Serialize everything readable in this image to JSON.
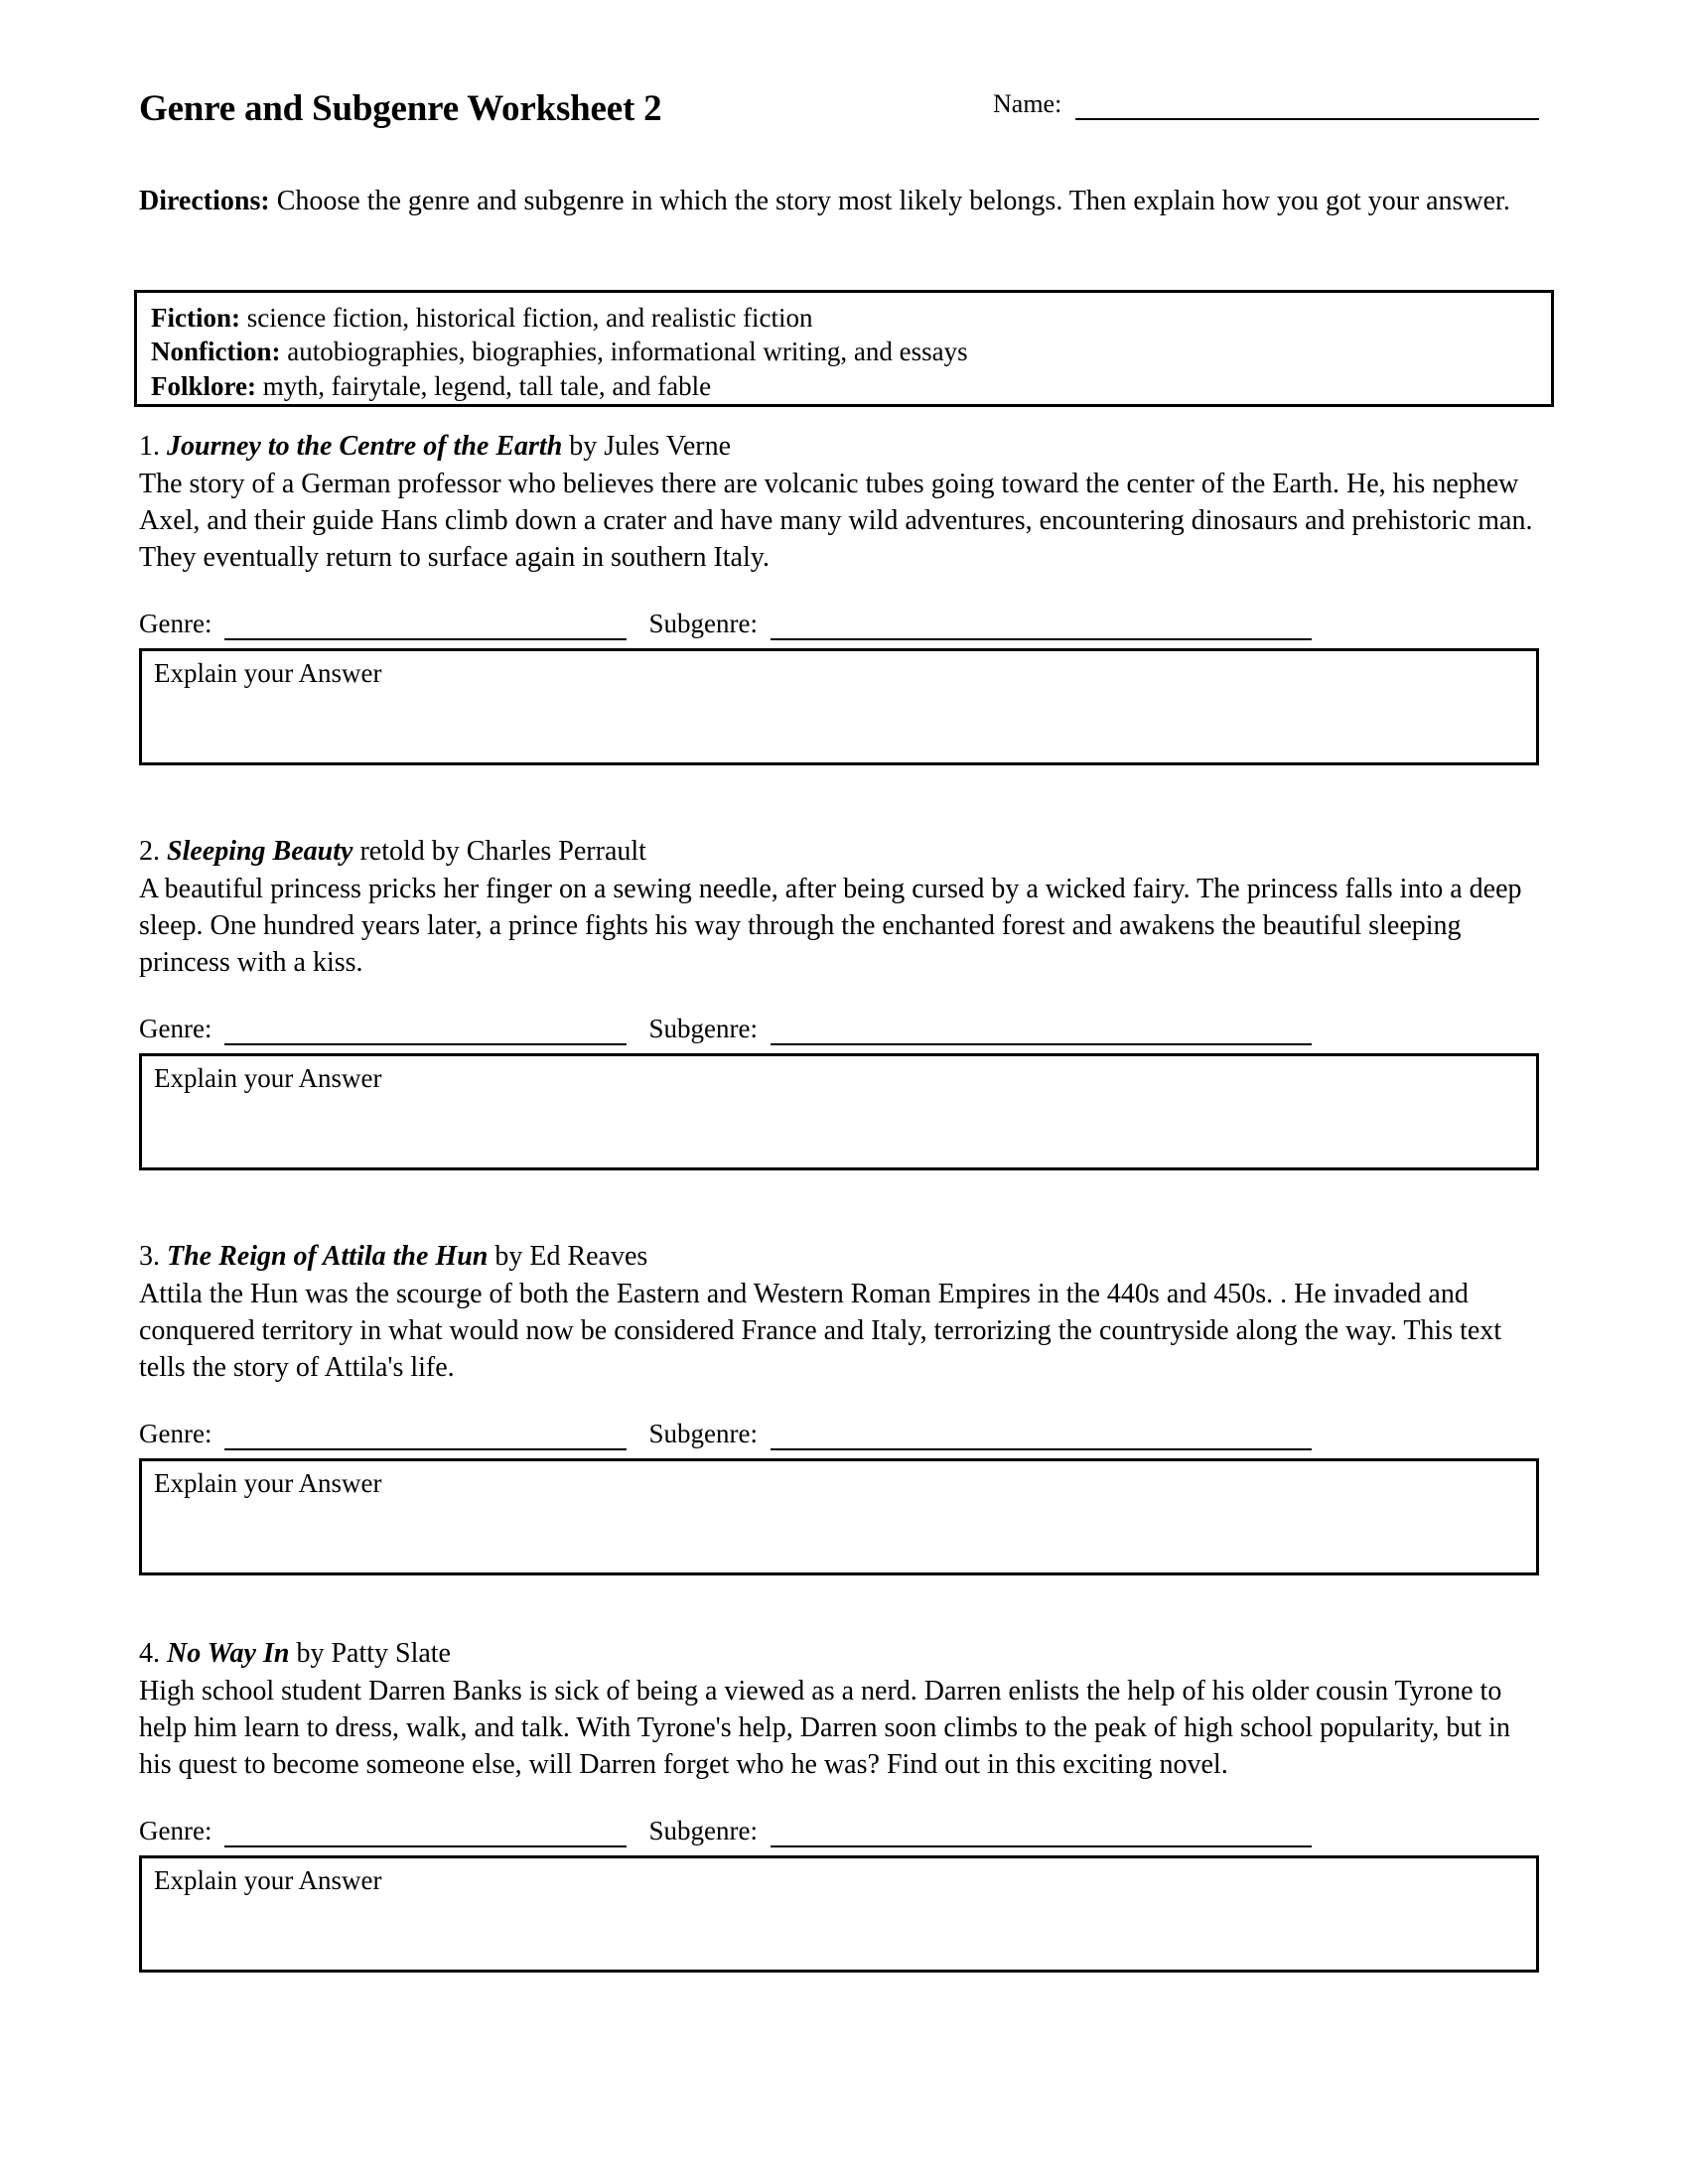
{
  "header": {
    "name_label": "Name:",
    "title": "Genre and Subgenre Worksheet 2"
  },
  "directions": {
    "label": "Directions:",
    "text": " Choose the genre and subgenre in which the story most likely belongs. Then explain how you got your answer."
  },
  "genre_key": {
    "rows": [
      {
        "label": "Fiction:",
        "values": " science fiction, historical fiction, and realistic fiction"
      },
      {
        "label": "Nonfiction:",
        "values": " autobiographies, biographies, informational writing, and essays"
      },
      {
        "label": "Folklore:",
        "values": " myth, fairytale, legend, tall tale, and fable"
      }
    ]
  },
  "labels": {
    "genre": "Genre:",
    "subgenre": "Subgenre:",
    "explain": "Explain your Answer"
  },
  "items": [
    {
      "number": "1.",
      "work": "Journey to the Centre of the Earth",
      "byline": " by Jules Verne",
      "summary": "The story of a German professor who believes there are volcanic tubes going toward the center of the Earth. He, his nephew Axel, and their guide Hans climb down a crater and have many wild adventures, encountering dinosaurs and prehistoric man. They eventually return to surface again in southern Italy."
    },
    {
      "number": "2.",
      "work": "Sleeping Beauty",
      "byline": " retold by Charles Perrault",
      "summary": "A beautiful princess pricks her finger on a sewing needle, after being cursed by a wicked fairy. The princess falls into a deep sleep. One hundred years later, a prince fights his way through the enchanted forest and awakens the beautiful sleeping princess with a kiss."
    },
    {
      "number": "3.",
      "work": "The Reign of Attila the Hun",
      "byline": " by Ed Reaves",
      "summary": "Attila the Hun was the scourge of both the Eastern and Western Roman Empires in the 440s and 450s. . He invaded and conquered territory in what would now be considered France and Italy, terrorizing the countryside along the way. This text tells the story of Attila's life."
    },
    {
      "number": "4.",
      "work": "No Way In",
      "byline": " by Patty Slate",
      "summary": "High school student Darren Banks is sick of being a viewed as a nerd. Darren enlists the help of his older cousin Tyrone to help him learn to dress, walk, and talk. With Tyrone's help, Darren soon climbs to the peak of high school popularity, but in his quest to become someone else, will Darren forget who he was? Find out in this exciting novel."
    }
  ]
}
